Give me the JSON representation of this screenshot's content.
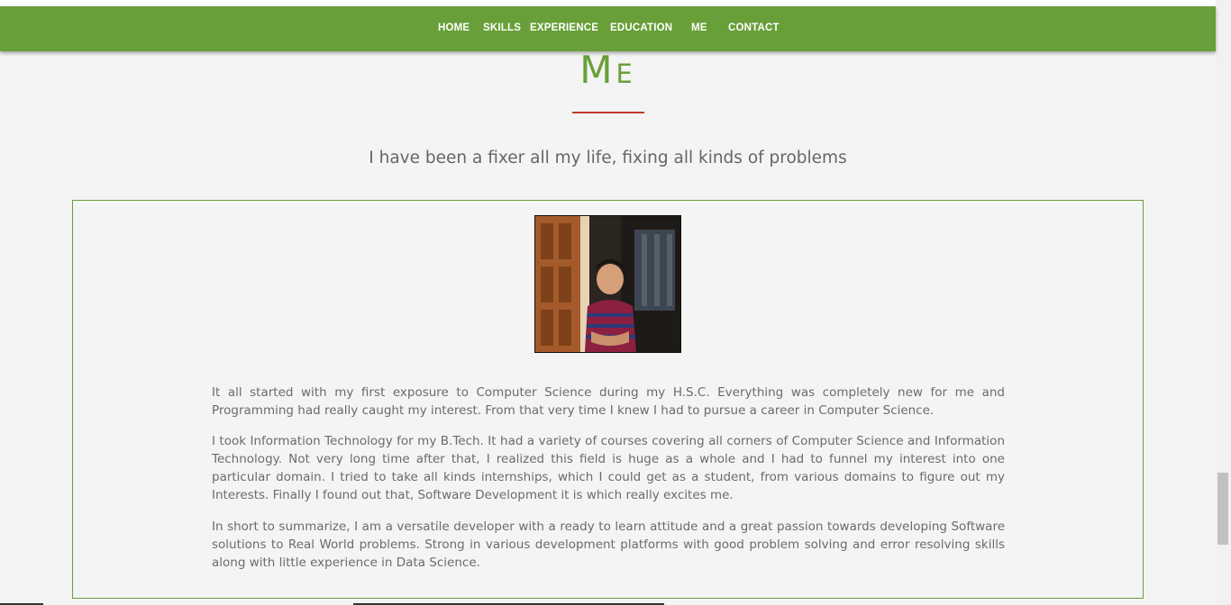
{
  "nav": {
    "items": [
      "HOME",
      "SKILLS",
      "EXPERIENCE",
      "EDUCATION",
      "ME",
      "CONTACT"
    ]
  },
  "section": {
    "title": "Me",
    "subtitle": "I have been a fixer all my life, fixing all kinds of problems"
  },
  "bio": {
    "paragraphs": [
      "It all started with my first exposure to Computer Science during my H.S.C. Everything was completely new for me and Programming had really caught my interest. From that very time I knew I had to pursue a career in Computer Science.",
      "I took Information Technology for my B.Tech. It had a variety of courses covering all corners of Computer Science and Information Technology. Not very long time after that, I realized this field is huge as a whole and I had to funnel my interest into one particular domain. I tried to take all kinds internships, which I could get as a student, from various domains to figure out my Interests. Finally I found out that, Software Development it is which really excites me.",
      "In short to summarize, I am a versatile developer with a ready to learn attitude and a great passion towards developing Software solutions to Real World problems. Strong in various development platforms with good problem solving and error resolving skills along with little experience in Data Science."
    ]
  },
  "colors": {
    "accent": "#689f38",
    "underline": "#c0392b",
    "background": "#f4f4f4",
    "text": "#6b6b6b"
  }
}
